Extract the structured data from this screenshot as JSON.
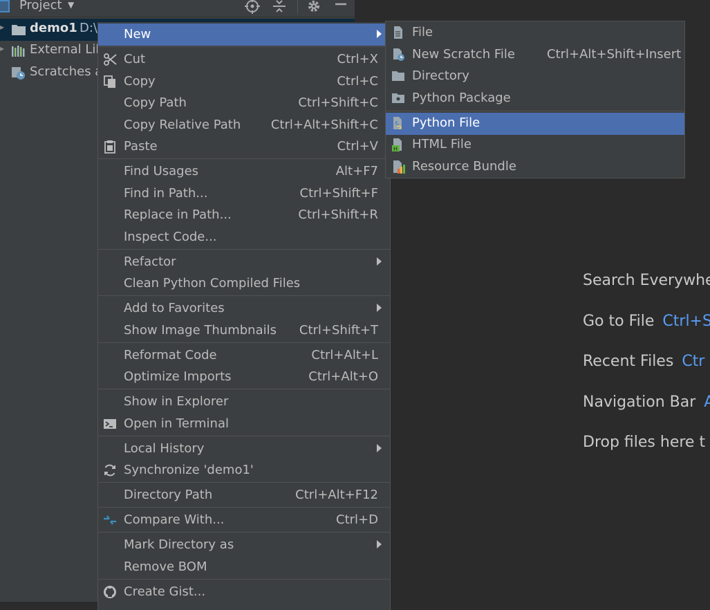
{
  "project": {
    "title": "Project",
    "tree": [
      {
        "label": "demo1",
        "path": "D:\\"
      },
      {
        "label": "External Lib"
      },
      {
        "label": "Scratches a"
      }
    ]
  },
  "context_menu": {
    "items": [
      {
        "label": "New",
        "shortcut": "",
        "submenu": true
      },
      {
        "label": "Cut",
        "shortcut": "Ctrl+X"
      },
      {
        "label": "Copy",
        "shortcut": "Ctrl+C"
      },
      {
        "label": "Copy Path",
        "shortcut": "Ctrl+Shift+C"
      },
      {
        "label": "Copy Relative Path",
        "shortcut": "Ctrl+Alt+Shift+C"
      },
      {
        "label": "Paste",
        "shortcut": "Ctrl+V"
      },
      {
        "label": "Find Usages",
        "shortcut": "Alt+F7"
      },
      {
        "label": "Find in Path...",
        "shortcut": "Ctrl+Shift+F"
      },
      {
        "label": "Replace in Path...",
        "shortcut": "Ctrl+Shift+R"
      },
      {
        "label": "Inspect Code...",
        "shortcut": ""
      },
      {
        "label": "Refactor",
        "shortcut": "",
        "submenu": true
      },
      {
        "label": "Clean Python Compiled Files",
        "shortcut": ""
      },
      {
        "label": "Add to Favorites",
        "shortcut": "",
        "submenu": true
      },
      {
        "label": "Show Image Thumbnails",
        "shortcut": "Ctrl+Shift+T"
      },
      {
        "label": "Reformat Code",
        "shortcut": "Ctrl+Alt+L"
      },
      {
        "label": "Optimize Imports",
        "shortcut": "Ctrl+Alt+O"
      },
      {
        "label": "Show in Explorer",
        "shortcut": ""
      },
      {
        "label": "Open in Terminal",
        "shortcut": ""
      },
      {
        "label": "Local History",
        "shortcut": "",
        "submenu": true
      },
      {
        "label": "Synchronize 'demo1'",
        "shortcut": ""
      },
      {
        "label": "Directory Path",
        "shortcut": "Ctrl+Alt+F12"
      },
      {
        "label": "Compare With...",
        "shortcut": "Ctrl+D"
      },
      {
        "label": "Mark Directory as",
        "shortcut": "",
        "submenu": true
      },
      {
        "label": "Remove BOM",
        "shortcut": ""
      },
      {
        "label": "Create Gist...",
        "shortcut": ""
      }
    ]
  },
  "submenu_new": {
    "items": [
      {
        "label": "File",
        "shortcut": ""
      },
      {
        "label": "New Scratch File",
        "shortcut": "Ctrl+Alt+Shift+Insert"
      },
      {
        "label": "Directory",
        "shortcut": ""
      },
      {
        "label": "Python Package",
        "shortcut": ""
      },
      {
        "label": "Python File",
        "shortcut": ""
      },
      {
        "label": "HTML File",
        "shortcut": ""
      },
      {
        "label": "Resource Bundle",
        "shortcut": ""
      }
    ]
  },
  "editor_hints": [
    {
      "label": "Search Everywhe",
      "key": ""
    },
    {
      "label": "Go to File",
      "key": "Ctrl+S"
    },
    {
      "label": "Recent Files",
      "key": "Ctr"
    },
    {
      "label": "Navigation Bar",
      "key": "A"
    },
    {
      "label": "Drop files here t",
      "key": ""
    }
  ],
  "colors": {
    "menu_bg": "#3c3f41",
    "highlight": "#4b6eaf",
    "editor_bg": "#2b2b2b",
    "shortcut_key": "#589df6"
  },
  "icons": {
    "cut": "scissors-icon",
    "copy": "copy-icon",
    "paste": "clipboard-icon",
    "terminal": "terminal-icon",
    "sync": "sync-icon",
    "compare": "compare-arrows-icon",
    "gist": "github-icon"
  }
}
